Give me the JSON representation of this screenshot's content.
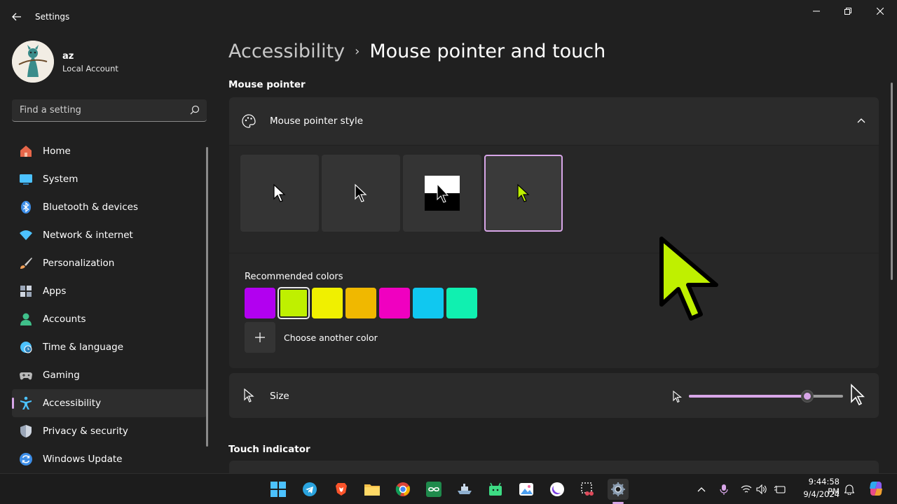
{
  "window": {
    "title": "Settings"
  },
  "user": {
    "name": "az",
    "account_type": "Local Account"
  },
  "search": {
    "placeholder": "Find a setting"
  },
  "sidebar": {
    "items": [
      {
        "label": "Home",
        "icon": "home-icon",
        "color": "#e8674a"
      },
      {
        "label": "System",
        "icon": "system-icon",
        "color": "#4cc2ff"
      },
      {
        "label": "Bluetooth & devices",
        "icon": "bluetooth-icon",
        "color": "#3d8ee8"
      },
      {
        "label": "Network & internet",
        "icon": "wifi-icon",
        "color": "#4cc2ff"
      },
      {
        "label": "Personalization",
        "icon": "brush-icon",
        "color": "#f0a05a"
      },
      {
        "label": "Apps",
        "icon": "apps-icon",
        "color": "#9aa6b8"
      },
      {
        "label": "Accounts",
        "icon": "accounts-icon",
        "color": "#3fc08a"
      },
      {
        "label": "Time & language",
        "icon": "clock-globe-icon",
        "color": "#4cc2ff"
      },
      {
        "label": "Gaming",
        "icon": "gamepad-icon",
        "color": "#b8b8b8"
      },
      {
        "label": "Accessibility",
        "icon": "accessibility-icon",
        "color": "#4cc2ff"
      },
      {
        "label": "Privacy & security",
        "icon": "shield-icon",
        "color": "#9aa6b8"
      },
      {
        "label": "Windows Update",
        "icon": "update-icon",
        "color": "#3d8ee8"
      }
    ],
    "active_index": 9
  },
  "breadcrumb": {
    "parent": "Accessibility",
    "separator": "›",
    "current": "Mouse pointer and touch"
  },
  "mouse_pointer": {
    "section_title": "Mouse pointer",
    "style_label": "Mouse pointer style",
    "styles": [
      {
        "name": "white",
        "selected": false
      },
      {
        "name": "black",
        "selected": false
      },
      {
        "name": "inverted",
        "selected": false
      },
      {
        "name": "custom",
        "selected": true
      }
    ],
    "recommended_colors_label": "Recommended colors",
    "colors": [
      "#b200f0",
      "#bff000",
      "#f0f000",
      "#f0b800",
      "#f000c0",
      "#10c8f0",
      "#10f0b0"
    ],
    "selected_color_index": 1,
    "choose_color_label": "Choose another color",
    "size_label": "Size",
    "size_value_fraction": 0.77,
    "accent": "#d8a6e8"
  },
  "touch": {
    "section_title": "Touch indicator"
  },
  "taskbar": {
    "apps": [
      "windows-start-icon",
      "telegram-icon",
      "brave-icon",
      "file-explorer-icon",
      "chrome-icon",
      "infinity-app-icon",
      "ship-app-icon",
      "android-studio-icon",
      "photos-app-icon",
      "vpn-app-icon",
      "snipping-tool-icon",
      "settings-gear-icon"
    ],
    "active_app": "settings-gear-icon",
    "time": "9:44:58 PM",
    "date": "9/4/2024"
  }
}
